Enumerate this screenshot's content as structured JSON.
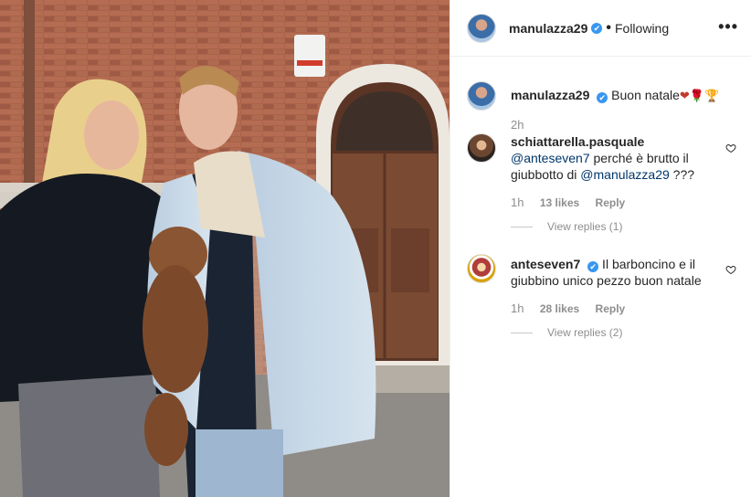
{
  "post": {
    "username": "manulazza29",
    "verified_mark": "✔",
    "separator": "•",
    "follow_status": "Following",
    "more_icon": "•••",
    "caption_text": "Buon natale",
    "caption_emojis": "❤🌹🏆",
    "caption_age": "2h"
  },
  "comments": [
    {
      "username": "schiattarella.pasquale",
      "mention": "@anteseven7",
      "text_middle": " perché è brutto il giubbotto di ",
      "mention2": "@manulazza29",
      "text_end": " ???",
      "age": "1h",
      "likes": "13 likes",
      "reply": "Reply",
      "view_replies": "View replies (1)"
    },
    {
      "username": "anteseven7",
      "verified_mark": "✔",
      "text": " Il barboncino e il giubbino unico pezzo buon natale",
      "age": "1h",
      "likes": "28 likes",
      "reply": "Reply",
      "view_replies": "View replies (2)"
    }
  ],
  "colors": {
    "verified": "#3897f0",
    "mention": "#00376b",
    "muted": "#8e8e8e"
  },
  "icons": [
    "heart-outline-icon",
    "more-options-icon",
    "verified-badge-icon"
  ]
}
